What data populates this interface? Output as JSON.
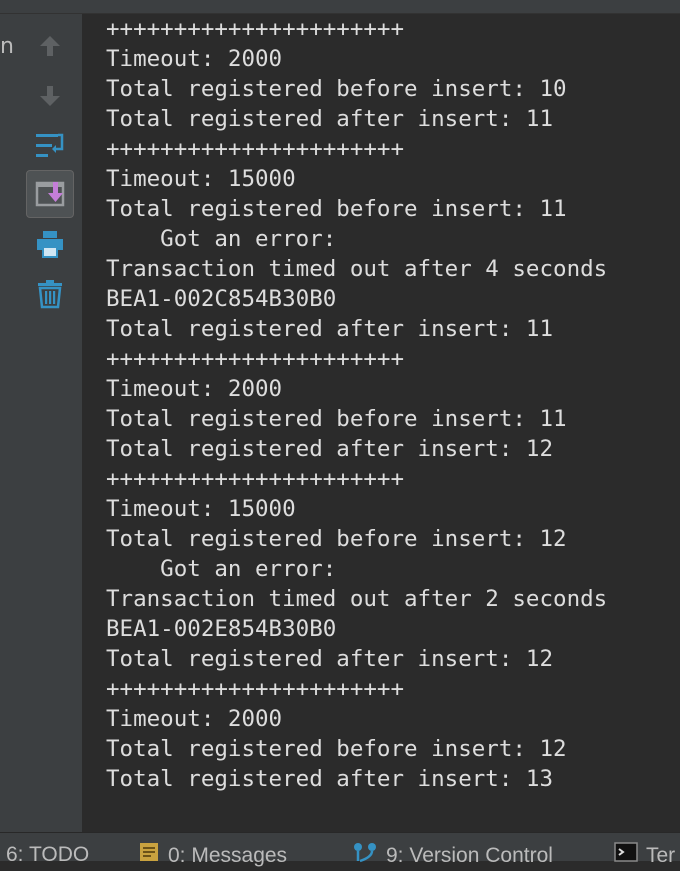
{
  "left_edge": {
    "fragment": "n"
  },
  "toolbar": {
    "buttons": [
      {
        "name": "up-arrow",
        "active": false
      },
      {
        "name": "down-arrow",
        "active": false
      },
      {
        "name": "soft-wrap",
        "active": false
      },
      {
        "name": "scroll-to-end",
        "active": true
      },
      {
        "name": "print",
        "active": false
      },
      {
        "name": "trash",
        "active": false
      }
    ]
  },
  "console": {
    "lines": [
      "++++++++++++++++++++++",
      "Timeout: 2000",
      "Total registered before insert: 10",
      "Total registered after insert: 11",
      "++++++++++++++++++++++",
      "Timeout: 15000",
      "Total registered before insert: 11",
      "    Got an error:",
      "Transaction timed out after 4 seconds",
      "BEA1-002C854B30B0",
      "Total registered after insert: 11",
      "++++++++++++++++++++++",
      "Timeout: 2000",
      "Total registered before insert: 11",
      "Total registered after insert: 12",
      "++++++++++++++++++++++",
      "Timeout: 15000",
      "Total registered before insert: 12",
      "    Got an error:",
      "Transaction timed out after 2 seconds",
      "BEA1-002E854B30B0",
      "Total registered after insert: 12",
      "++++++++++++++++++++++",
      "Timeout: 2000",
      "Total registered before insert: 12",
      "Total registered after insert: 13"
    ]
  },
  "statusbar": {
    "todo": "6: TODO",
    "messages": "0: Messages",
    "version_control": "9: Version Control",
    "terminal": "Ter"
  },
  "colors": {
    "background": "#2b2b2b",
    "panel": "#3c3f41",
    "text": "#dddddd",
    "icon_blue": "#3592c4"
  }
}
